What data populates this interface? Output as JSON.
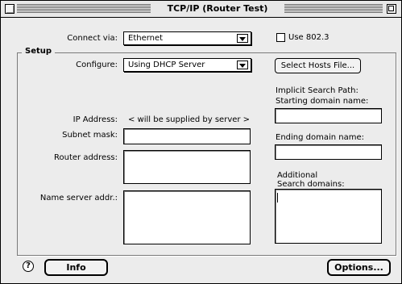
{
  "window": {
    "title": "TCP/IP (Router Test)"
  },
  "connect": {
    "label": "Connect via:",
    "value": "Ethernet"
  },
  "use8023": {
    "label": "Use 802.3",
    "checked": false
  },
  "setup": {
    "group_label": "Setup",
    "configure": {
      "label": "Configure:",
      "value": "Using DHCP Server"
    },
    "select_hosts_label": "Select Hosts File...",
    "ip_label": "IP Address:",
    "ip_value": "< will be supplied by server >",
    "subnet_label": "Subnet mask:",
    "router_label": "Router address:",
    "nameserver_label": "Name server addr.:",
    "implicit_search_label": "Implicit Search Path:",
    "starting_domain_label": "Starting domain name:",
    "ending_domain_label": "Ending domain name:",
    "additional_label": "Additional",
    "search_domains_label": "Search domains:"
  },
  "footer": {
    "help_symbol": "?",
    "info_label": "Info",
    "options_label": "Options..."
  },
  "icons": {
    "close": "close-box-icon",
    "zoom": "zoom-box-icon",
    "popup_arrow": "chevron-down-icon",
    "help": "help-icon"
  }
}
